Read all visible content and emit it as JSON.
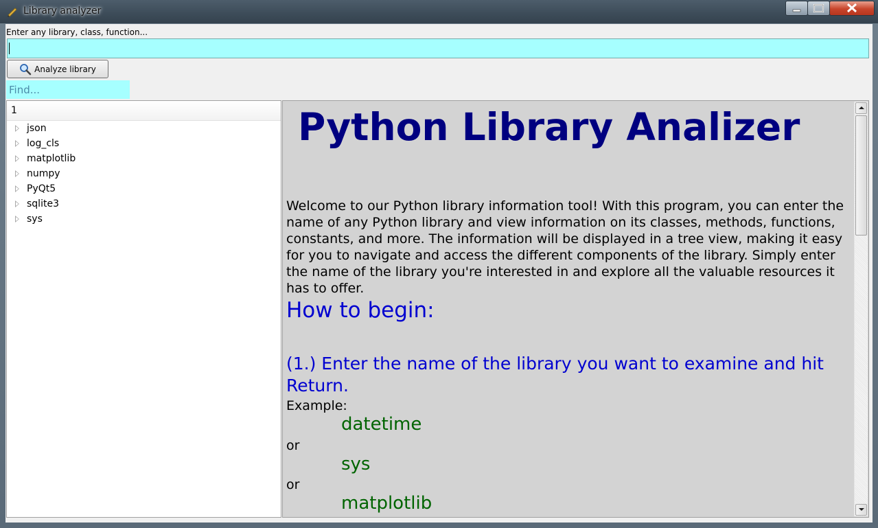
{
  "window": {
    "title": "Library analyzer",
    "icon": "ruler-pencil-icon"
  },
  "search": {
    "label": "Enter any library, class, function...",
    "value": "",
    "analyze_label": "Analyze library",
    "analyze_icon": "magnifier-icon",
    "find_placeholder": "Find..."
  },
  "tree": {
    "header": "1",
    "items": [
      "json",
      "log_cls",
      "matplotlib",
      "numpy",
      "PyQt5",
      "sqlite3",
      "sys"
    ]
  },
  "doc": {
    "title": "Python Library Analizer",
    "intro": "Welcome to our Python library information tool! With this program, you can enter the name of any Python library and view information on its classes, methods, functions, constants, and more. The information will be displayed in a tree view, making it easy for you to navigate and access the different components of the library. Simply enter the name of the library you're interested in and explore all the valuable resources it has to offer.",
    "how_to": "How to begin:",
    "step1": "(1.) Enter the name of the library you want to examine and hit Return.",
    "example_label": "Example:",
    "examples": [
      "datetime",
      "sys",
      "matplotlib"
    ],
    "or": "or"
  },
  "colors": {
    "input_bg": "#a6ffff",
    "title": "#000080",
    "heading": "#0000d0",
    "code": "#006400",
    "doc_bg": "#d3d3d3"
  }
}
